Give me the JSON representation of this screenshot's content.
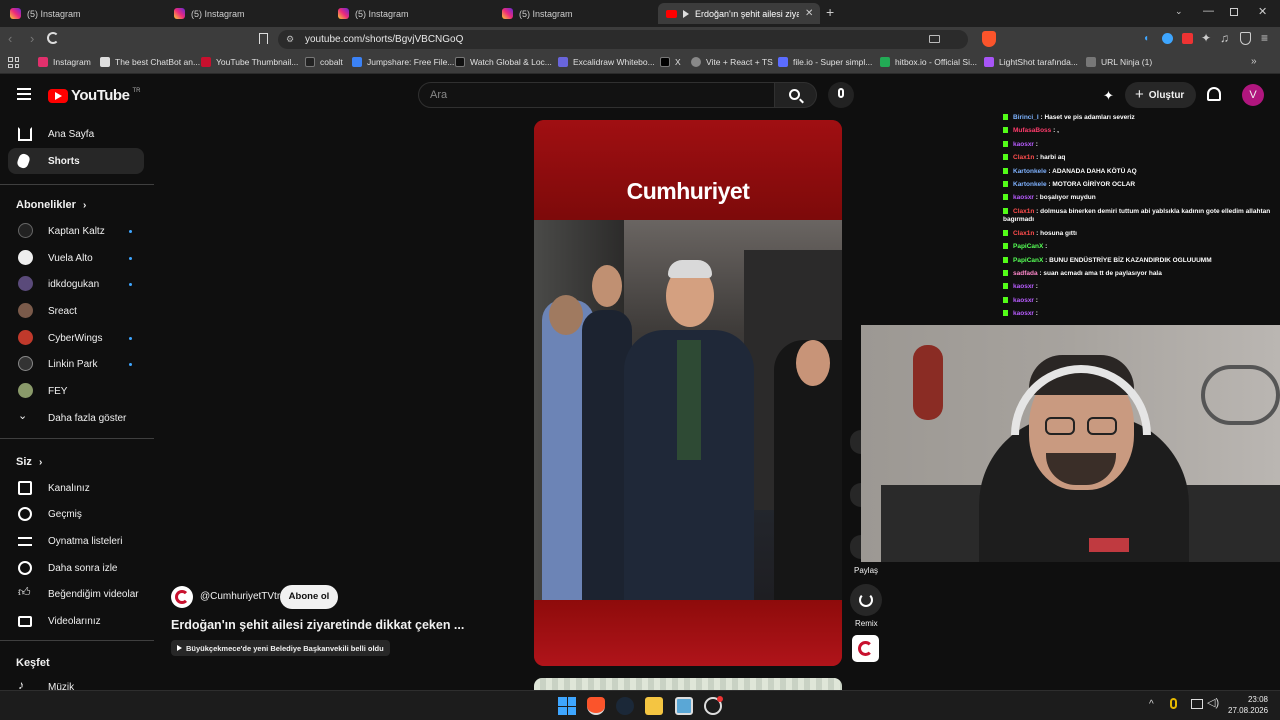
{
  "browser": {
    "tabs": [
      {
        "label": "(5) Instagram"
      },
      {
        "label": "(5) Instagram"
      },
      {
        "label": "(5) Instagram"
      },
      {
        "label": "(5) Instagram"
      },
      {
        "label": "Erdoğan'ın şehit ailesi ziyareti"
      }
    ],
    "url": "youtube.com/shorts/BgvjVBCNGoQ",
    "bookmarks": [
      {
        "label": "Instagram",
        "color": "#e1306c"
      },
      {
        "label": "The best ChatBot an...",
        "color": "#dddddd"
      },
      {
        "label": "YouTube Thumbnail...",
        "color": "#c8102e"
      },
      {
        "label": "cobalt",
        "color": "#222222"
      },
      {
        "label": "Jumpshare: Free File...",
        "color": "#3b82f6"
      },
      {
        "label": "Watch Global & Loc...",
        "color": "#111111"
      },
      {
        "label": "Excalidraw Whitebo...",
        "color": "#6965db"
      },
      {
        "label": "X",
        "color": "#000000"
      },
      {
        "label": "Vite + React + TS",
        "color": "#888888"
      },
      {
        "label": "file.io - Super simpl...",
        "color": "#5b6cff"
      },
      {
        "label": "hitbox.io - Official Si...",
        "color": "#22aa55"
      },
      {
        "label": "LightShot tarafında...",
        "color": "#a855f7"
      },
      {
        "label": "URL Ninja (1)",
        "color": "#777777"
      }
    ]
  },
  "youtube": {
    "logo": "YouTube",
    "logo_sup": "TR",
    "search_placeholder": "Ara",
    "create_label": "Oluştur",
    "avatar_letter": "V",
    "sidebar": {
      "home": "Ana Sayfa",
      "shorts": "Shorts",
      "subs_header": "Abonelikler",
      "subscriptions": [
        {
          "label": "Kaptan Kaltz",
          "color": "#222222"
        },
        {
          "label": "Vuela Alto",
          "color": "#eeeeee"
        },
        {
          "label": "idkdogukan",
          "color": "#5a4a7a"
        },
        {
          "label": "Sreact",
          "color": "#7a5a4a"
        },
        {
          "label": "CyberWings",
          "color": "#c0392b"
        },
        {
          "label": "Linkin Park",
          "color": "#333333"
        },
        {
          "label": "FEY",
          "color": "#8a9a6a"
        }
      ],
      "show_more": "Daha fazla göster",
      "you_header": "Siz",
      "you_items": [
        "Kanalınız",
        "Geçmiş",
        "Oynatma listeleri",
        "Daha sonra izle",
        "Beğendiğim videolar",
        "Videolarınız"
      ],
      "explore_header": "Keşfet",
      "explore_items": [
        "Müzik"
      ]
    },
    "short": {
      "brand": "Cumhuriyet",
      "channel": "@CumhuriyetTVtr",
      "subscribe": "Abone ol",
      "title": "Erdoğan'ın şehit ailesi ziyaretinde dikkat çeken ...",
      "related": "Büyükçekmece'de yeni Belediye Başkanvekili belli oldu"
    },
    "actions": {
      "share": "Paylaş",
      "remix": "Remix"
    }
  },
  "stream_chat": [
    {
      "user": "Birinci_I",
      "color": "#7db3ff",
      "msg": "Haset ve pis adamları severiz"
    },
    {
      "user": "MufasaBoss",
      "color": "#ff3b6b",
      "msg": ","
    },
    {
      "user": "kaosxr",
      "color": "#b85cff",
      "msg": ""
    },
    {
      "user": "Clax1n",
      "color": "#ff4d4d",
      "msg": "harbi aq"
    },
    {
      "user": "Kartonkele",
      "color": "#7fb2ff",
      "msg": "ADANADA DAHA KÖTÜ AQ"
    },
    {
      "user": "Kartonkele",
      "color": "#7fb2ff",
      "msg": "MOTORA GİRİYOR OCLAR"
    },
    {
      "user": "kaosxr",
      "color": "#b85cff",
      "msg": "boşalıyor muydun"
    },
    {
      "user": "Clax1n",
      "color": "#ff4d4d",
      "msg": "dolmusa binerken demiri tuttum abi yablsıkla kadının gote elledim allahtan bagırmadı"
    },
    {
      "user": "Clax1n",
      "color": "#ff4d4d",
      "msg": "hosuna gıttı"
    },
    {
      "user": "PapiCanX",
      "color": "#55ff55",
      "msg": ""
    },
    {
      "user": "PapiCanX",
      "color": "#55ff55",
      "msg": "BUNU ENDÜSTRİYE BİZ KAZANDIRDIK OGLUUUMM"
    },
    {
      "user": "sadfada",
      "color": "#ff88cc",
      "msg": "suan acmadı ama tt de paylasıyor hala"
    },
    {
      "user": "kaosxr",
      "color": "#b85cff",
      "msg": ""
    },
    {
      "user": "kaosxr",
      "color": "#b85cff",
      "msg": ""
    },
    {
      "user": "kaosxr",
      "color": "#b85cff",
      "msg": ""
    }
  ],
  "taskbar": {
    "time": "23:08",
    "date": "27.08.2026"
  }
}
